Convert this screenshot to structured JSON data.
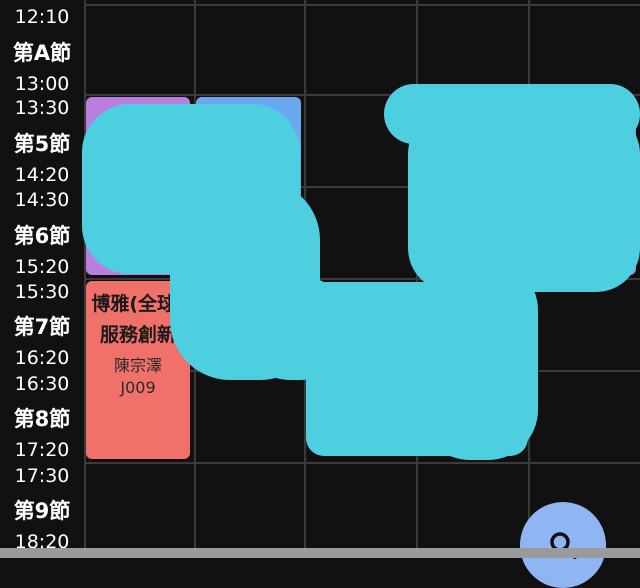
{
  "timetable": {
    "rows": [
      {
        "start": "12:10"
      },
      {
        "period": "第A節",
        "start": "13:00"
      },
      {
        "start": "13:30",
        "period": "第5節",
        "end": "14:20"
      },
      {
        "start": "14:30",
        "period": "第6節",
        "end": "15:20"
      },
      {
        "start": "15:30",
        "period": "第7節",
        "end": "16:20"
      },
      {
        "start": "16:30",
        "period": "第8節",
        "end": "17:20"
      },
      {
        "start": "17:30",
        "period": "第9節",
        "end": "18:20"
      }
    ],
    "course": {
      "name": "博雅(全球)服務創新",
      "teacher": "陳宗澤",
      "room": "J009",
      "color": "#f0706a"
    },
    "hidden_cards": [
      {
        "color": "#b97ee0"
      },
      {
        "color": "#6aa8f0"
      },
      {
        "color": "#b97ee0"
      }
    ],
    "scribble_color": "#4dcfe0"
  },
  "fab": {
    "icon": "search-icon"
  }
}
